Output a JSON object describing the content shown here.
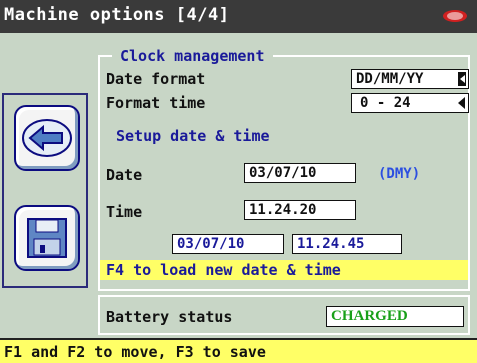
{
  "window": {
    "title": "Machine options [4/4]"
  },
  "clock": {
    "group_title": "Clock management",
    "date_format_label": "Date format",
    "date_format_value": "DD/MM/YY",
    "format_time_label": "Format time",
    "format_time_value": "0 - 24",
    "setup_title": "Setup date & time",
    "date_label": "Date",
    "date_value": "03/07/10",
    "date_hint": "(DMY)",
    "time_label": "Time",
    "time_value": "11.24.20",
    "current_date": "03/07/10",
    "current_time": "11.24.45",
    "load_hint": "F4 to load new date & time"
  },
  "battery": {
    "label": "Battery status",
    "value": "CHARGED"
  },
  "footer": {
    "hint": "F1 and F2 to move, F3 to save"
  },
  "icons": {
    "back": "back-arrow-icon",
    "save": "floppy-disk-icon",
    "logo": "brand-logo-icon"
  },
  "colors": {
    "background": "#c8d6c6",
    "titlebar": "#3a3a3a",
    "highlight": "#ffff66",
    "accent_text": "#1a1a9a",
    "status_ok": "#18a018"
  }
}
